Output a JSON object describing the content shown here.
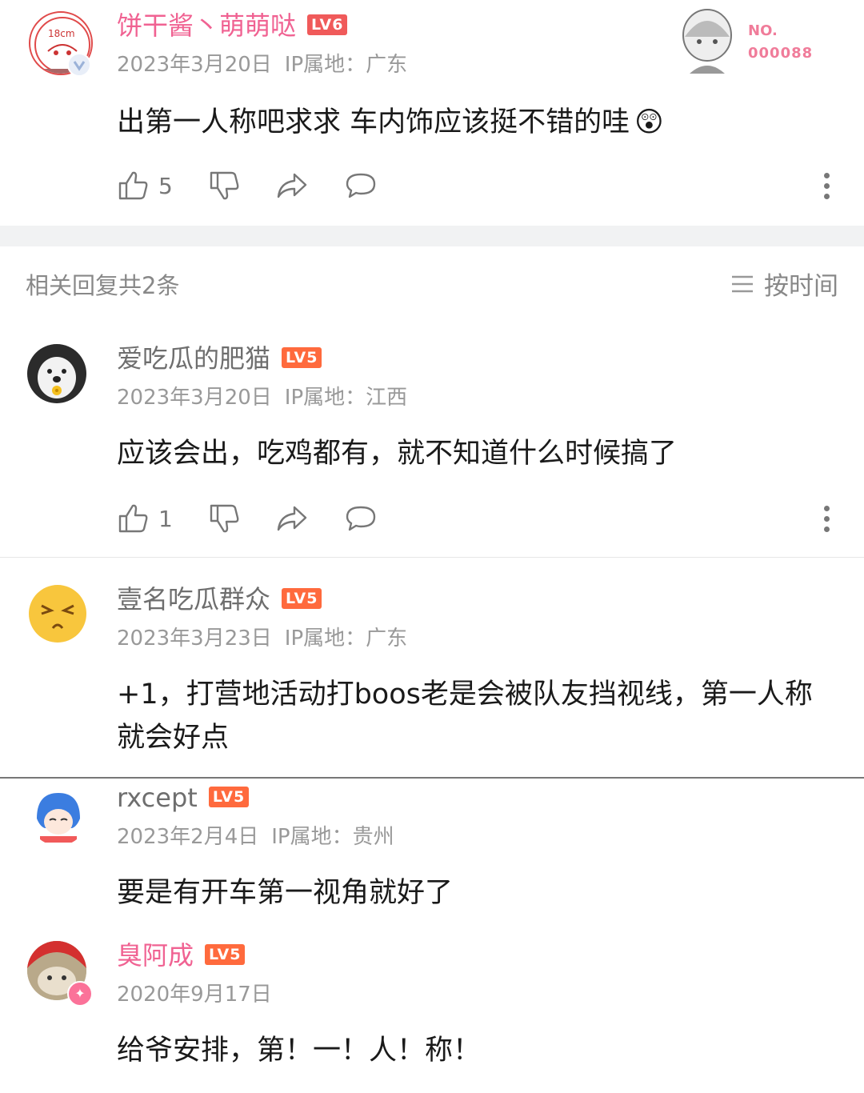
{
  "main_comment": {
    "username": "饼干酱丶萌萌哒",
    "level": "LV6",
    "date": "2023年3月20日",
    "ip": "IP属地：广东",
    "text": "出第一人称吧求求 车内饰应该挺不错的哇",
    "emoji": "😲",
    "likes": "5",
    "fan_card": {
      "label": "NO.",
      "number": "000088"
    }
  },
  "replies_header": {
    "count_text": "相关回复共2条",
    "sort_label": "按时间"
  },
  "replies": [
    {
      "username": "爱吃瓜的肥猫",
      "level": "LV5",
      "date": "2023年3月20日",
      "ip": "IP属地：江西",
      "text": "应该会出，吃鸡都有，就不知道什么时候搞了",
      "likes": "1"
    },
    {
      "username": "壹名吃瓜群众",
      "level": "LV5",
      "date": "2023年3月23日",
      "ip": "IP属地：广东",
      "text": "+1，打营地活动打boos老是会被队友挡视线，第一人称就会好点"
    },
    {
      "username": "rxcept",
      "level": "LV5",
      "date": "2023年2月4日",
      "ip": "IP属地：贵州",
      "text": "要是有开车第一视角就好了"
    },
    {
      "username": "臭阿成",
      "level": "LV5",
      "date": "2020年9月17日",
      "text": "给爷安排，第！一！人！称！"
    }
  ],
  "colors": {
    "vip_name": "#f06292",
    "lv5_badge": "#ff6a3d",
    "lv6_badge": "#f05a5a",
    "meta_text": "#999999"
  }
}
